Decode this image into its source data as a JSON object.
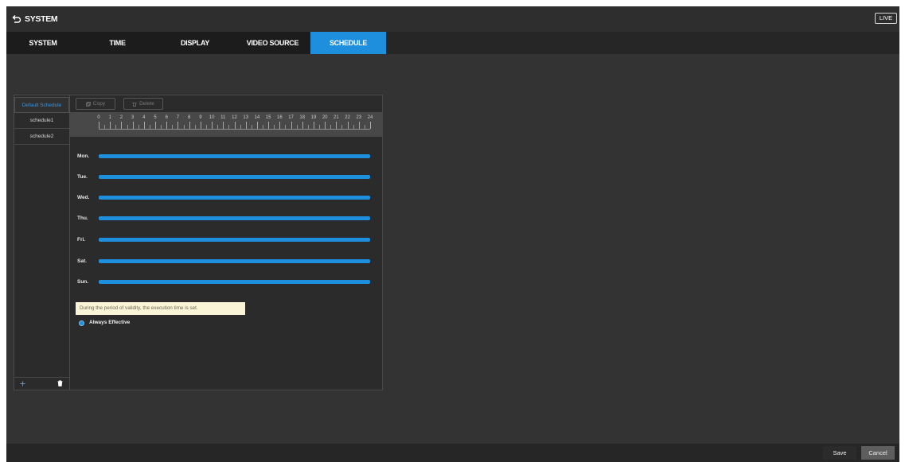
{
  "window": {
    "title": "SYSTEM",
    "live_label": "LIVE"
  },
  "tabs": [
    {
      "label": "SYSTEM",
      "active": false
    },
    {
      "label": "TIME",
      "active": false
    },
    {
      "label": "DISPLAY",
      "active": false
    },
    {
      "label": "VIDEO SOURCE",
      "active": false
    },
    {
      "label": "SCHEDULE",
      "active": true
    }
  ],
  "schedules": {
    "items": [
      {
        "label": "Default Schedule",
        "selected": true
      },
      {
        "label": "schedule1",
        "selected": false
      },
      {
        "label": "schedule2",
        "selected": false
      }
    ]
  },
  "toolbar": {
    "copy_label": "Copy",
    "delete_label": "Delete"
  },
  "timeline": {
    "hours": [
      0,
      1,
      2,
      3,
      4,
      5,
      6,
      7,
      8,
      9,
      10,
      11,
      12,
      13,
      14,
      15,
      16,
      17,
      18,
      19,
      20,
      21,
      22,
      23,
      24
    ]
  },
  "days": [
    {
      "label": "Mon.",
      "periods": [
        [
          0,
          24
        ]
      ]
    },
    {
      "label": "Tue.",
      "periods": [
        [
          0,
          24
        ]
      ]
    },
    {
      "label": "Wed.",
      "periods": [
        [
          0,
          24
        ]
      ]
    },
    {
      "label": "Thu.",
      "periods": [
        [
          0,
          24
        ]
      ]
    },
    {
      "label": "Fri.",
      "periods": [
        [
          0,
          24
        ]
      ]
    },
    {
      "label": "Sat.",
      "periods": [
        [
          0,
          24
        ]
      ]
    },
    {
      "label": "Sun.",
      "periods": [
        [
          0,
          24
        ]
      ]
    }
  ],
  "note": "During the period of validity, the execution time is set.",
  "validity": {
    "option_label": "Always Effective",
    "selected": true
  },
  "footer": {
    "save_label": "Save",
    "cancel_label": "Cancel"
  },
  "colors": {
    "accent": "#1e8fdc",
    "selected_text": "#3d94dc",
    "note_bg": "#fbf4d6"
  },
  "icons": {
    "back": "back-arrow-icon",
    "copy": "copy-icon",
    "delete": "trash-icon",
    "add": "plus-icon"
  }
}
